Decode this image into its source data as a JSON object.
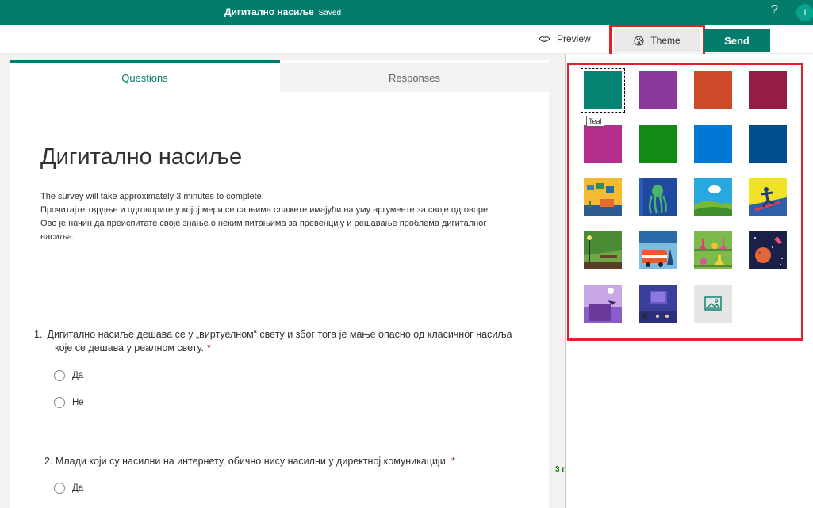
{
  "topbar": {
    "title": "Дигитално насиље",
    "saved": "Saved",
    "help": "?",
    "avatar_initial": "I"
  },
  "commandbar": {
    "preview_label": "Preview",
    "theme_label": "Theme",
    "send_label": "Send",
    "more_label": "···"
  },
  "tabs": {
    "questions": "Questions",
    "responses": "Responses"
  },
  "form": {
    "title": "Дигитално насиље",
    "description": [
      "The survey will take approximately 3 minutes to complete.",
      "Прочитајте тврдње и одговорите у којој мери се са њима слажете имајући на уму аргументе за своје одговоре.",
      "Ово је начин да преиспитате своје знање о неким питањима за превенцију и решавање проблема дигиталног",
      "насиља."
    ],
    "questions": [
      {
        "number": "1.",
        "text": "Дигитално насиље дешава се у „виртуелном“ свету и због тога је мање опасно од класичног насиља које се дешава у реалном свету.",
        "required": "*",
        "options": [
          "Да",
          "Не"
        ]
      },
      {
        "number": "2.",
        "text": "Млади који су насилни на интернету, обично нису насилни у директној комуникацији.",
        "required": "*",
        "options": [
          "Да"
        ]
      }
    ]
  },
  "side_link": "3 г",
  "theme_panel": {
    "tooltip": "Teal",
    "swatch_colors": [
      "#058373",
      "#8b3a9b",
      "#cc4a28",
      "#941d48",
      "#b52e8c",
      "#128a13",
      "#0078d4",
      "#004d8e"
    ],
    "image_themes": [
      "workspace",
      "octopus",
      "cloud-hills",
      "snowboarder",
      "park-bench",
      "camper-van",
      "science-lab",
      "space-planet",
      "desk-lamp",
      "keyboard-monitor"
    ],
    "upload_icon": "image-icon"
  }
}
